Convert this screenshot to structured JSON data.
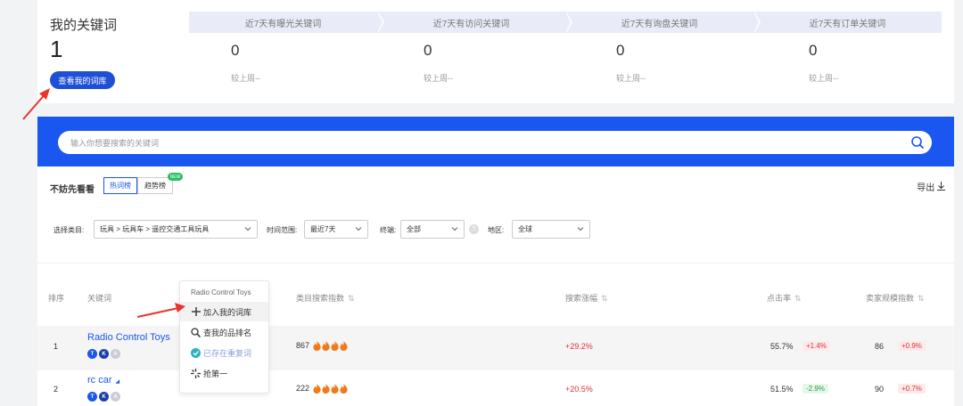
{
  "my_keywords": {
    "title": "我的关键词",
    "count": "1",
    "view_button": "查看我的词库"
  },
  "stats": [
    {
      "label": "近7天有曝光关键词",
      "value": "0",
      "compare": "较上周--"
    },
    {
      "label": "近7天有访问关键词",
      "value": "0",
      "compare": "较上周--"
    },
    {
      "label": "近7天有询盘关键词",
      "value": "0",
      "compare": "较上周--"
    },
    {
      "label": "近7天有订单关键词",
      "value": "0",
      "compare": "较上周--"
    }
  ],
  "search": {
    "placeholder": "输入你想要搜索的关键词"
  },
  "section": {
    "title": "不妨先看看",
    "tabs": [
      "热词榜",
      "趋势榜"
    ],
    "new_badge": "NEW",
    "export": "导出"
  },
  "filters": {
    "category_label": "选择类目:",
    "category_value": "玩具 > 玩具车 > 遥控交通工具玩具",
    "time_label": "时间范围:",
    "time_value": "最近7天",
    "terminal_label": "终端:",
    "terminal_value": "全部",
    "region_label": "地区:",
    "region_value": "全球"
  },
  "table": {
    "headers": [
      "排序",
      "关键词",
      "类目搜索指数",
      "搜索涨幅",
      "点击率",
      "卖家规模指数"
    ],
    "rows": [
      {
        "rank": "1",
        "keyword": "Radio Control Toys",
        "search_index": "867",
        "flames": 4,
        "growth": "+29.2%",
        "ctr": "55.7%",
        "ctr_change": "+1.4%",
        "ctr_dir": "up",
        "seller": "86",
        "seller_change": "+0.9%",
        "seller_dir": "up"
      },
      {
        "rank": "2",
        "keyword": "rc car",
        "search_index": "222",
        "flames": 4,
        "growth": "+20.5%",
        "ctr": "51.5%",
        "ctr_change": "-2.9%",
        "ctr_dir": "down",
        "seller": "90",
        "seller_change": "+0.7%",
        "seller_dir": "up"
      }
    ],
    "badges": [
      "T",
      "K",
      "A"
    ]
  },
  "popup": {
    "title": "Radio Control Toys",
    "items": [
      "加入我的词库",
      "查我的品排名",
      "已存在重复词",
      "抢第一"
    ]
  },
  "colors": {
    "accent": "#1a56f0",
    "danger": "#e0303c",
    "success": "#2f9a47",
    "flame": "#f07a1a"
  }
}
